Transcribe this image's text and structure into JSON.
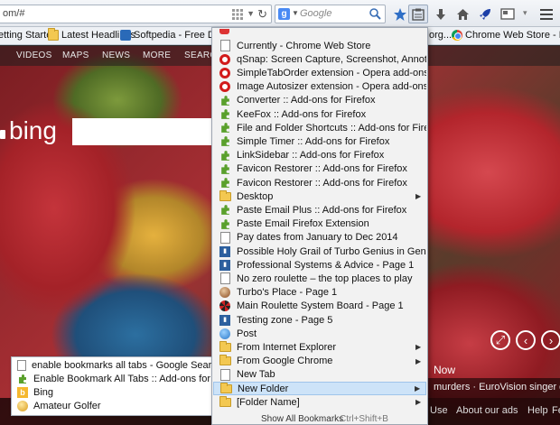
{
  "toolbar": {
    "url": "om/#",
    "search_engine_letter": "g",
    "search_placeholder": "Google"
  },
  "bookmarks_toolbar": [
    {
      "label": "etting Started",
      "icon": "page-icon"
    },
    {
      "label": "Latest Headlines",
      "icon": "rss-folder-icon"
    },
    {
      "label": "Softpedia - Free Downl...",
      "icon": "softpedia-icon"
    },
    {
      "label": "org...",
      "icon": "page-icon"
    },
    {
      "label": "Chrome Web Store - P...",
      "icon": "chrome-icon"
    }
  ],
  "bing": {
    "nav": [
      "VIDEOS",
      "MAPS",
      "NEWS",
      "MORE",
      "SEARCH"
    ],
    "logo": "bing",
    "now_label": "Now",
    "headlines": "murders · EuroVision singer dies",
    "footer_links": [
      "Use",
      "About our ads",
      "Help",
      "Fe"
    ]
  },
  "autocomplete": [
    {
      "label": "enable bookmarks all tabs - Google Search",
      "icon": "google-icon"
    },
    {
      "label": "Enable Bookmark All Tabs :: Add-ons for Firefox",
      "icon": "addon-icon"
    },
    {
      "label": "Bing",
      "icon": "bing-icon"
    },
    {
      "label": "Amateur Golfer",
      "icon": "golf-icon"
    }
  ],
  "bookmarks_menu": {
    "items": [
      {
        "label": "Currently - Chrome Web Store",
        "icon": "chrome",
        "submenu": false
      },
      {
        "label": "qSnap: Screen Capture, Screenshot, Annotation ext...",
        "icon": "opera",
        "submenu": false
      },
      {
        "label": "SimpleTabOrder extension - Opera add-ons",
        "icon": "opera",
        "submenu": false
      },
      {
        "label": "Image Autosizer extension - Opera add-ons",
        "icon": "opera",
        "submenu": false
      },
      {
        "label": "Converter :: Add-ons for Firefox",
        "icon": "puzzle",
        "submenu": false
      },
      {
        "label": "KeeFox :: Add-ons for Firefox",
        "icon": "puzzle",
        "submenu": false
      },
      {
        "label": "File and Folder Shortcuts :: Add-ons for Firefox",
        "icon": "puzzle",
        "submenu": false
      },
      {
        "label": "Simple Timer :: Add-ons for Firefox",
        "icon": "puzzle",
        "submenu": false
      },
      {
        "label": "LinkSidebar :: Add-ons for Firefox",
        "icon": "puzzle",
        "submenu": false
      },
      {
        "label": "Favicon Restorer :: Add-ons for Firefox",
        "icon": "puzzle",
        "submenu": false
      },
      {
        "label": "Favicon Restorer :: Add-ons for Firefox",
        "icon": "puzzle",
        "submenu": false
      },
      {
        "label": "Desktop",
        "icon": "folder",
        "submenu": true
      },
      {
        "label": "Paste Email Plus :: Add-ons for Firefox",
        "icon": "puzzle",
        "submenu": false
      },
      {
        "label": "Paste Email Firefox Extension",
        "icon": "puzzle",
        "submenu": false
      },
      {
        "label": "Pay dates from January to Dec 2014",
        "icon": "page",
        "submenu": false
      },
      {
        "label": "Possible Holy Grail of Turbo Genius in General Disc...",
        "icon": "roulette-site",
        "submenu": false
      },
      {
        "label": "Professional Systems & Advice - Page 1",
        "icon": "roulette-site",
        "submenu": false
      },
      {
        "label": "No zero roulette – the top places to play",
        "icon": "page",
        "submenu": false
      },
      {
        "label": "Turbo's Place - Page 1",
        "icon": "turbo",
        "submenu": false
      },
      {
        "label": "Main Roulette System Board - Page 1",
        "icon": "roulette",
        "submenu": false
      },
      {
        "label": "Testing zone - Page 5",
        "icon": "roulette-site",
        "submenu": false
      },
      {
        "label": "Post",
        "icon": "globe",
        "submenu": false
      },
      {
        "label": "From Internet Explorer",
        "icon": "folder",
        "submenu": true
      },
      {
        "label": "From Google Chrome",
        "icon": "folder",
        "submenu": true
      },
      {
        "label": "New Tab",
        "icon": "page",
        "submenu": false
      },
      {
        "label": "New Folder",
        "icon": "folder",
        "submenu": true
      },
      {
        "label": "[Folder Name]",
        "icon": "folder",
        "submenu": true
      }
    ],
    "highlighted_index": 25,
    "show_all": "Show All Bookmarks",
    "show_all_shortcut": "Ctrl+Shift+B"
  }
}
